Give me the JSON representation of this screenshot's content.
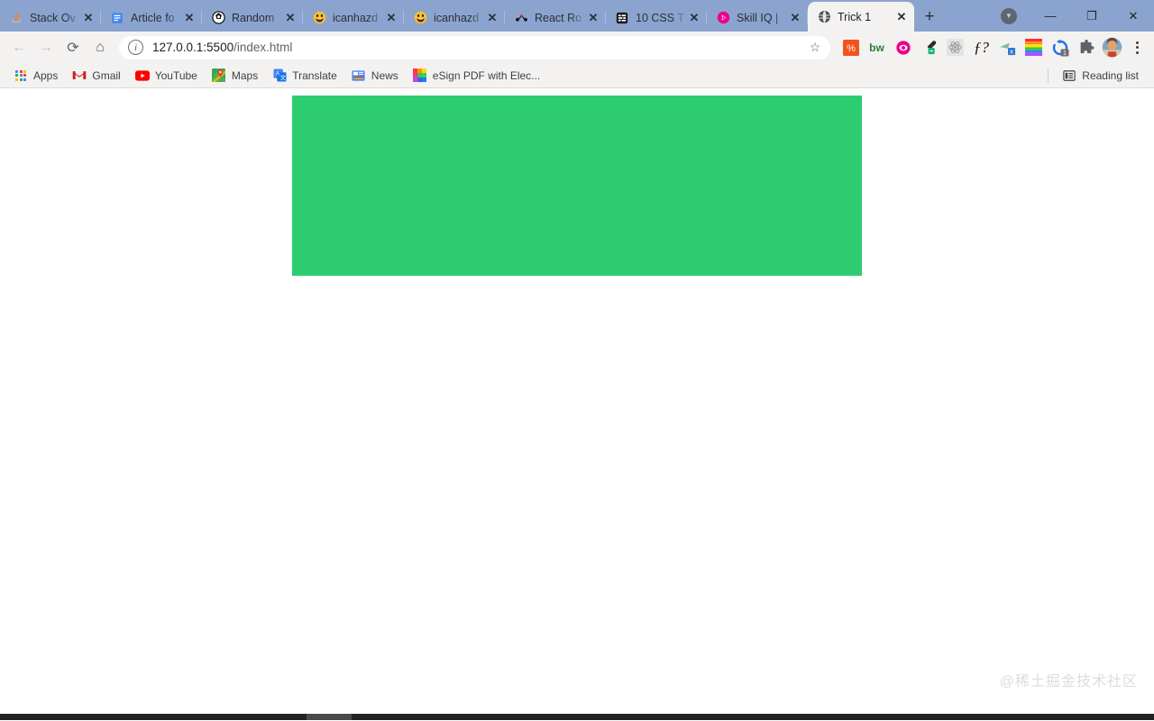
{
  "window": {
    "controls": [
      {
        "name": "profile-chevron",
        "glyph": "▼"
      },
      {
        "name": "minimize",
        "glyph": "—"
      },
      {
        "name": "maximize",
        "glyph": "❐"
      },
      {
        "name": "close",
        "glyph": "✕"
      }
    ]
  },
  "tabstrip": {
    "new_tab_label": "+",
    "tabs": [
      {
        "title": "Stack Ov",
        "icon": "stackoverflow-favicon",
        "icon_glyph": "🥞",
        "close": "✕",
        "active": false
      },
      {
        "title": "Article fo",
        "icon": "document-favicon",
        "icon_glyph": "▤",
        "close": "✕",
        "active": false
      },
      {
        "title": "Random",
        "icon": "random-favicon",
        "icon_glyph": "◈",
        "close": "✕",
        "active": false
      },
      {
        "title": "icanhazd",
        "icon": "smiley-favicon",
        "icon_glyph": "😀",
        "close": "✕",
        "active": false
      },
      {
        "title": "icanhazd",
        "icon": "smiley-favicon",
        "icon_glyph": "😀",
        "close": "✕",
        "active": false
      },
      {
        "title": "React Ro",
        "icon": "react-router-favicon",
        "icon_glyph": "✦",
        "close": "✕",
        "active": false
      },
      {
        "title": "10 CSS T",
        "icon": "css-tricks-favicon",
        "icon_glyph": "▤",
        "close": "✕",
        "active": false
      },
      {
        "title": "Skill IQ |",
        "icon": "pluralsight-favicon",
        "icon_glyph": "◉",
        "close": "✕",
        "active": false
      },
      {
        "title": "Trick 1",
        "icon": "globe-favicon",
        "icon_glyph": "🌐",
        "close": "✕",
        "active": true
      }
    ]
  },
  "toolbar": {
    "back_label": "←",
    "forward_label": "→",
    "reload_label": "⟳",
    "home_label": "⌂",
    "site_info_label": "i",
    "url_secure_part": "127.0.0.1:5500",
    "url_path_part": "/index.html",
    "url_full": "127.0.0.1:5500/index.html",
    "bookmark_star": "☆",
    "extensions": [
      {
        "name": "percent-extension",
        "glyph": "%",
        "color": "#ffffff",
        "bg": "#f4511e"
      },
      {
        "name": "bw-extension",
        "glyph": "bw",
        "color": "#2e7d32",
        "bg": "transparent"
      },
      {
        "name": "eye-extension",
        "glyph": "◉",
        "color": "#ec008c",
        "bg": "transparent"
      },
      {
        "name": "eyedropper-extension",
        "glyph": "⚲",
        "color": "#333333",
        "bg": "transparent"
      },
      {
        "name": "react-devtools-extension",
        "glyph": "⚛",
        "color": "#bdbdbd",
        "bg": "#e4e4e4"
      },
      {
        "name": "fonts-extension",
        "glyph": "ƒ?",
        "color": "#1a1a1a",
        "bg": "transparent"
      },
      {
        "name": "excel-extension",
        "glyph": "x",
        "color": "#ffffff",
        "bg": "#217346"
      },
      {
        "name": "rainbow-extension",
        "glyph": "",
        "color": "#ffffff",
        "bg": "#ff0000"
      },
      {
        "name": "sync-extension",
        "glyph": "↻",
        "color": "#1a73e8",
        "bg": "transparent",
        "badge": "1"
      },
      {
        "name": "puzzle-extension",
        "glyph": "🧩",
        "color": "#5f6368",
        "bg": "transparent"
      }
    ],
    "avatar_label": "",
    "menu_label": "⋮"
  },
  "bookmarks": {
    "items": [
      {
        "label": "Apps",
        "icon": "apps-grid-icon"
      },
      {
        "label": "Gmail",
        "icon": "gmail-icon",
        "glyph": "M"
      },
      {
        "label": "YouTube",
        "icon": "youtube-icon",
        "glyph": "▶"
      },
      {
        "label": "Maps",
        "icon": "maps-icon",
        "glyph": "📍"
      },
      {
        "label": "Translate",
        "icon": "translate-icon",
        "glyph": "文"
      },
      {
        "label": "News",
        "icon": "news-icon",
        "glyph": "📰"
      },
      {
        "label": "eSign PDF with Elec...",
        "icon": "esign-icon",
        "glyph": ""
      }
    ],
    "reading_list_label": "Reading list",
    "reading_list_icon": "reading-list-icon"
  },
  "page": {
    "green_box_color": "#2ecc71",
    "background_color": "#ffffff",
    "watermark_text": "@稀土掘金技术社区"
  }
}
